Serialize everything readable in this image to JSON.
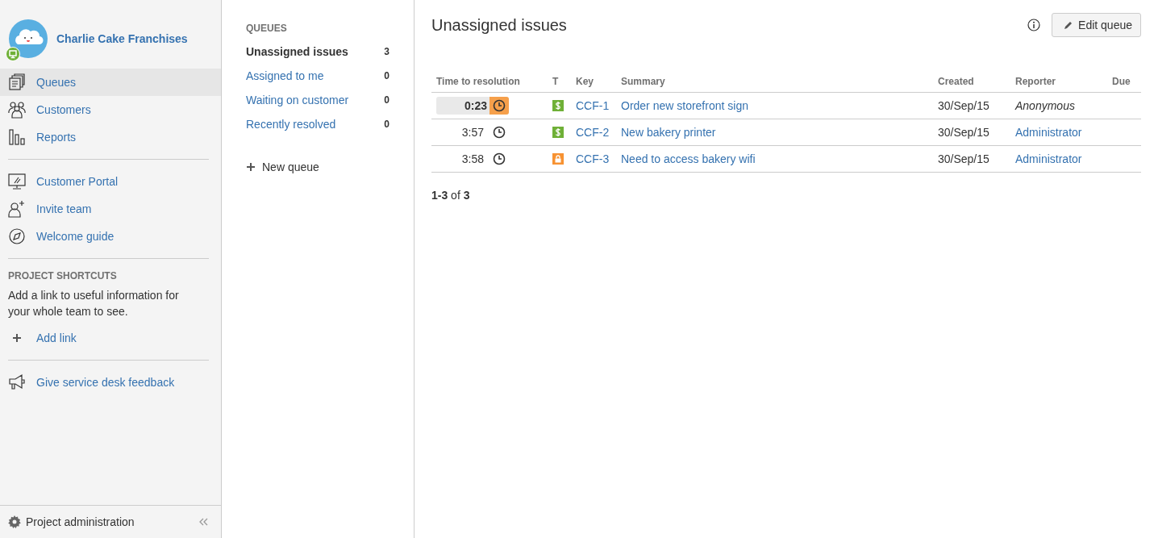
{
  "project": {
    "name": "Charlie Cake Franchises"
  },
  "nav": [
    {
      "label": "Queues",
      "selected": true
    },
    {
      "label": "Customers",
      "selected": false
    },
    {
      "label": "Reports",
      "selected": false
    }
  ],
  "links": [
    {
      "label": "Customer Portal"
    },
    {
      "label": "Invite team"
    },
    {
      "label": "Welcome guide"
    }
  ],
  "shortcuts": {
    "heading": "PROJECT SHORTCUTS",
    "text": "Add a link to useful information for your whole team to see.",
    "add_link": "Add link"
  },
  "feedback": "Give service desk feedback",
  "footer": {
    "label": "Project administration"
  },
  "queues": {
    "heading": "QUEUES",
    "items": [
      {
        "label": "Unassigned issues",
        "count": "3",
        "selected": true
      },
      {
        "label": "Assigned to me",
        "count": "0",
        "selected": false
      },
      {
        "label": "Waiting on customer",
        "count": "0",
        "selected": false
      },
      {
        "label": "Recently resolved",
        "count": "0",
        "selected": false
      }
    ],
    "new_queue": "New queue"
  },
  "main": {
    "title": "Unassigned issues",
    "edit_button": "Edit queue",
    "columns": [
      "Time to resolution",
      "T",
      "Key",
      "Summary",
      "Created",
      "Reporter",
      "Due"
    ],
    "rows": [
      {
        "time": "0:23",
        "warning": true,
        "kind": "service",
        "key": "CCF-1",
        "summary": "Order new storefront sign",
        "created": "30/Sep/15",
        "reporter": "Anonymous",
        "anonymous": true
      },
      {
        "time": "3:57",
        "warning": false,
        "kind": "service",
        "key": "CCF-2",
        "summary": "New bakery printer",
        "created": "30/Sep/15",
        "reporter": "Administrator",
        "anonymous": false
      },
      {
        "time": "3:58",
        "warning": false,
        "kind": "access",
        "key": "CCF-3",
        "summary": "Need to access bakery wifi",
        "created": "30/Sep/15",
        "reporter": "Administrator",
        "anonymous": false
      }
    ],
    "pagination": "**1-3** of **3**"
  }
}
